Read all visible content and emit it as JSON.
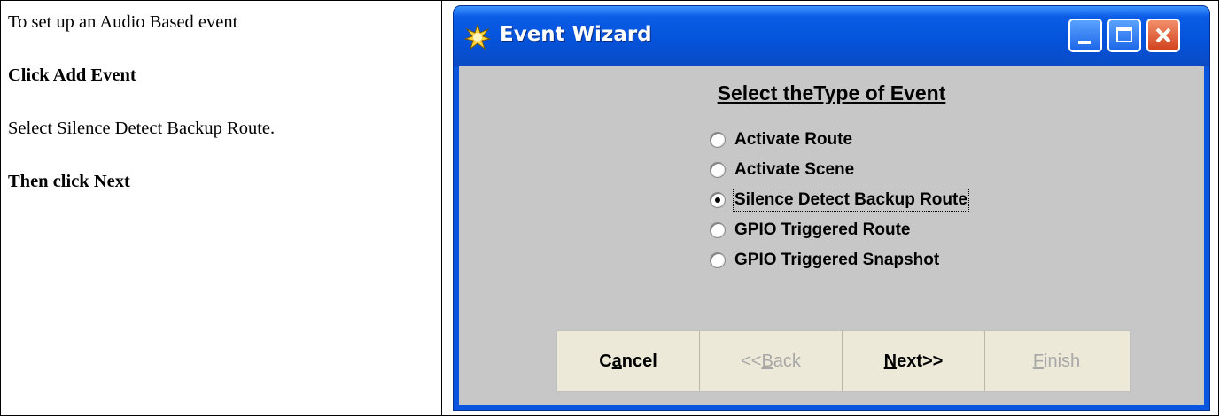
{
  "doc": {
    "intro": "To set up an Audio Based event",
    "step1": "Click Add Event",
    "step2": "Select Silence Detect Backup Route.",
    "step3": "Then click Next"
  },
  "window": {
    "title": "Event Wizard",
    "heading": "Select theType of Event",
    "options": [
      {
        "label": "Activate Route",
        "checked": false
      },
      {
        "label": "Activate Scene",
        "checked": false
      },
      {
        "label": "Silence Detect Backup Route",
        "checked": true
      },
      {
        "label": "GPIO Triggered Route",
        "checked": false
      },
      {
        "label": "GPIO Triggered Snapshot",
        "checked": false
      }
    ],
    "buttons": {
      "cancel": {
        "pre": "C",
        "mnemonic": "a",
        "post": "ncel",
        "enabled": true
      },
      "back": {
        "pre": "<<",
        "mnemonic": "B",
        "post": "ack",
        "enabled": false
      },
      "next": {
        "pre": "",
        "mnemonic": "N",
        "post": "ext>>",
        "enabled": true
      },
      "finish": {
        "pre": "",
        "mnemonic": "F",
        "post": "inish",
        "enabled": false
      }
    }
  },
  "colors": {
    "titlebar": "#0552d9",
    "client_bg": "#c7c7c7",
    "button_bar": "#ece9d8",
    "close_button": "#d2421e"
  },
  "icons": [
    "app-burst-icon",
    "minimize-icon",
    "maximize-icon",
    "close-icon"
  ]
}
